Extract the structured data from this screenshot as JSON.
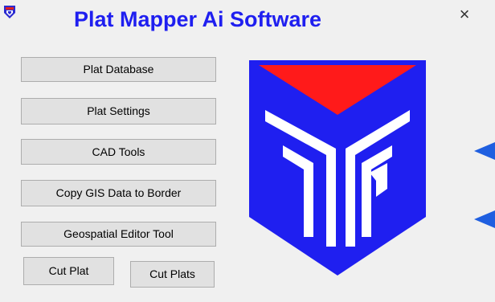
{
  "window": {
    "title": "Plat Mapper Ai Software",
    "close_glyph": "×",
    "app_icon": "app-shield-icon"
  },
  "menu": {
    "plat_database": "Plat Database",
    "plat_settings": "Plat Settings",
    "cad_tools": "CAD Tools",
    "copy_gis": "Copy GIS Data to Border",
    "geospatial_editor": "Geospatial Editor Tool",
    "cut_plat": "Cut Plat",
    "cut_plats": "Cut Plats"
  },
  "colors": {
    "title": "#1f1ff0",
    "logo_blue": "#1f1ff0",
    "logo_red": "#ff1a1a",
    "arrow_blue": "#1f5fe0"
  }
}
